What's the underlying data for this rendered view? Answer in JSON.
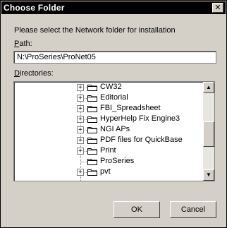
{
  "window": {
    "title": "Choose Folder",
    "close_glyph": "✕"
  },
  "prompt": "Please select the Network folder for installation",
  "path": {
    "label_first": "P",
    "label_rest": "ath:",
    "value": "N:\\ProSeries\\ProNet05"
  },
  "directories": {
    "label_first": "D",
    "label_rest": "irectories:",
    "items": [
      {
        "label": "CW32",
        "expander": "+"
      },
      {
        "label": "Editorial",
        "expander": "+"
      },
      {
        "label": "FBI_Spreadsheet",
        "expander": "+"
      },
      {
        "label": "HyperHelp Fix Engine3",
        "expander": "+"
      },
      {
        "label": "NGI APs",
        "expander": "+"
      },
      {
        "label": "PDF files for QuickBase",
        "expander": "+"
      },
      {
        "label": "Print",
        "expander": "+"
      },
      {
        "label": "ProSeries",
        "expander": ""
      },
      {
        "label": "pvt",
        "expander": "+"
      }
    ],
    "scroll_position": 0.55
  },
  "buttons": {
    "ok": "OK",
    "cancel": "Cancel"
  }
}
